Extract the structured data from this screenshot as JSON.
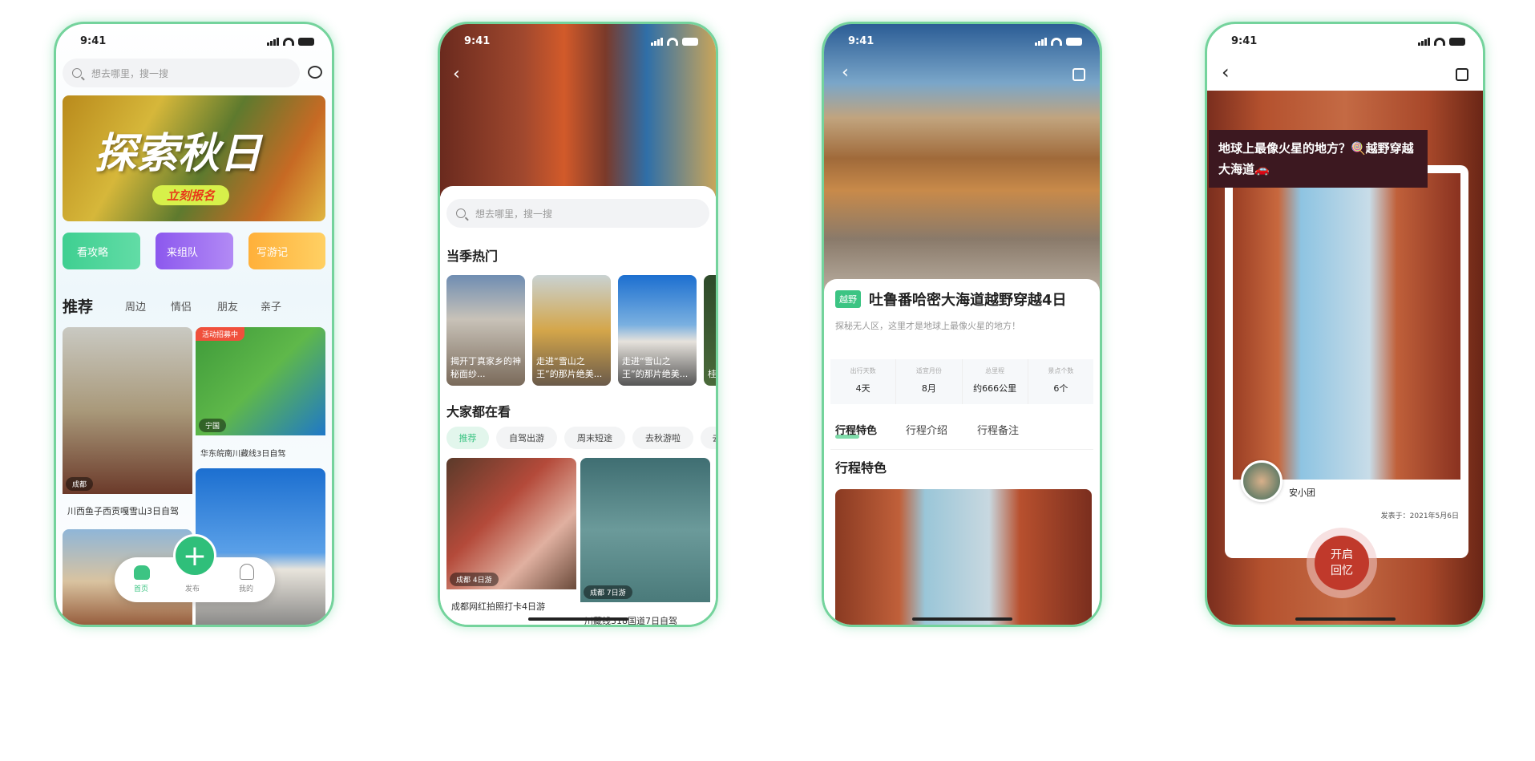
{
  "status": {
    "time": "9:41"
  },
  "colors": {
    "accent": "#3cc483",
    "frame": "#74d39c",
    "memory_button": "#c0392b"
  },
  "phone1": {
    "search_placeholder": "想去哪里，搜一搜",
    "banner": {
      "title": "探索秋日",
      "cta": "立刻报名"
    },
    "quick_actions": [
      {
        "label": "看攻略",
        "color": "#3fcf91"
      },
      {
        "label": "来组队",
        "color": "#9a66f0"
      },
      {
        "label": "写游记",
        "color": "#ffb84a"
      }
    ],
    "tabs": [
      "推荐",
      "周边",
      "情侣",
      "朋友",
      "亲子"
    ],
    "cards": [
      {
        "title": "川西鱼子西贡嘎雪山3日自驾",
        "location": "成都"
      },
      {
        "title": "华东皖南川藏线3日自驾",
        "location": "宁国",
        "badge": "活动招募中"
      }
    ],
    "nav": [
      {
        "label": "首页"
      },
      {
        "label": "发布"
      },
      {
        "label": "我的"
      }
    ]
  },
  "phone2": {
    "search_placeholder": "想去哪里，搜一搜",
    "section1": "当季热门",
    "hot": [
      "揭开丁真家乡的神秘面纱...",
      "走进“雪山之王”的那片绝美...",
      "走进“雪山之王”的那片绝美...",
      "桂"
    ],
    "section2": "大家都在看",
    "chips": [
      "推荐",
      "自驾出游",
      "周末短途",
      "去秋游啦",
      "去"
    ],
    "cards": [
      {
        "title": "成都网红拍照打卡4日游",
        "location": "成都",
        "days": "4日游"
      },
      {
        "title": "川藏线318国道7日自驾",
        "location": "成都",
        "days": "7日游"
      }
    ]
  },
  "phone3": {
    "tag": "越野",
    "title": "吐鲁番哈密大海道越野穿越4日",
    "subtitle": "探秘无人区，这里才是地球上最像火星的地方！",
    "stats": [
      {
        "label": "出行天数",
        "value": "4天"
      },
      {
        "label": "适宜月份",
        "value": "8月"
      },
      {
        "label": "总里程",
        "value": "约666公里"
      },
      {
        "label": "景点个数",
        "value": "6个"
      }
    ],
    "tabs": [
      "行程特色",
      "行程介绍",
      "行程备注"
    ],
    "section": "行程特色"
  },
  "phone4": {
    "title": "地球上最像火星的地方？🍭越野穿越大海道🚗",
    "author": "安小团",
    "date": "发表于：2021年5月6日",
    "button": [
      "开启",
      "回忆"
    ]
  }
}
